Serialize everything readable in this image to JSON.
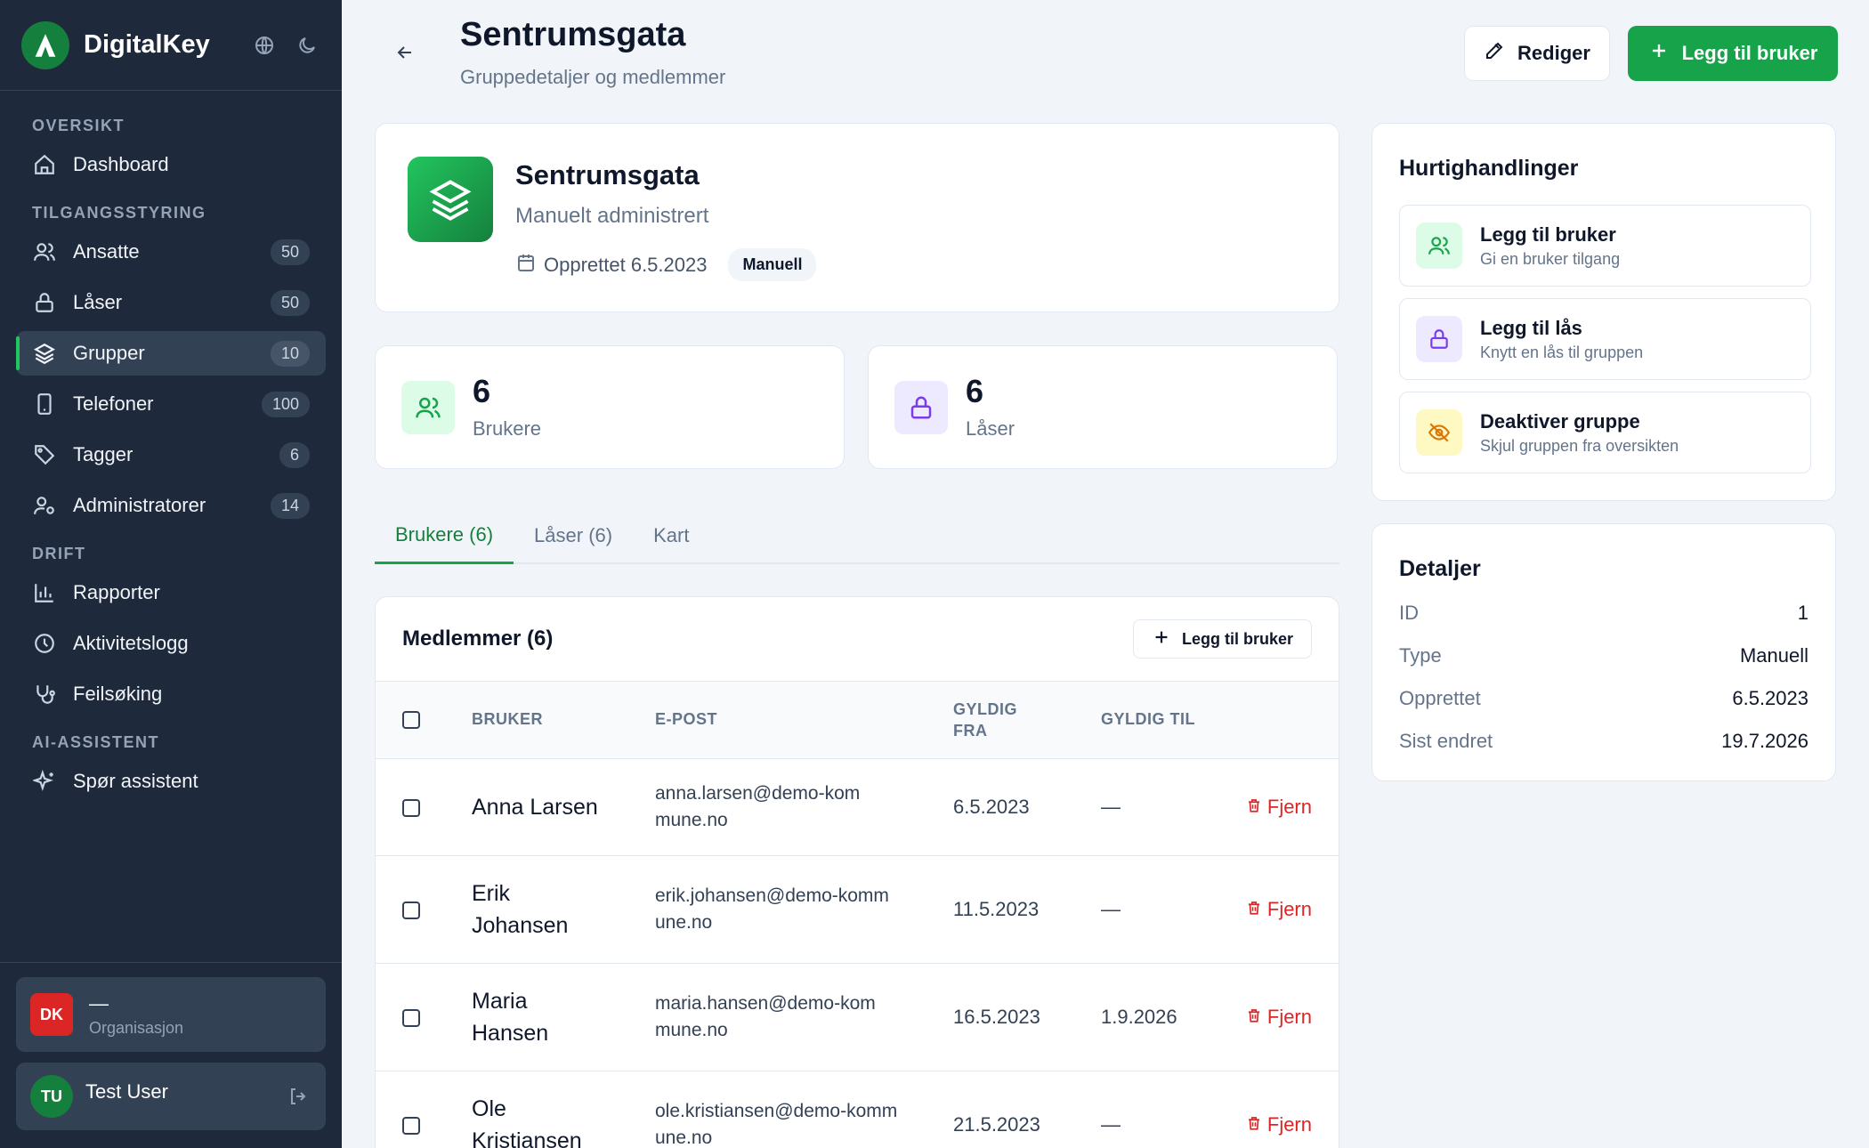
{
  "app": {
    "name": "DigitalKey"
  },
  "sidebar": {
    "sections": [
      {
        "title": "OVERSIKT"
      },
      {
        "title": "TILGANGSSTYRING"
      },
      {
        "title": "DRIFT"
      },
      {
        "title": "AI-ASSISTENT"
      }
    ],
    "items": [
      {
        "label": "Dashboard",
        "icon": "home-icon"
      },
      {
        "label": "Ansatte",
        "count": "50",
        "icon": "users-icon"
      },
      {
        "label": "Låser",
        "count": "50",
        "icon": "lock-icon"
      },
      {
        "label": "Grupper",
        "count": "10",
        "icon": "layers-icon",
        "active": true
      },
      {
        "label": "Telefoner",
        "count": "100",
        "icon": "phone-icon"
      },
      {
        "label": "Tagger",
        "count": "6",
        "icon": "tag-icon"
      },
      {
        "label": "Administratorer",
        "count": "14",
        "icon": "user-cog-icon"
      },
      {
        "label": "Rapporter",
        "icon": "bar-chart-icon"
      },
      {
        "label": "Aktivitetslogg",
        "icon": "clock-icon"
      },
      {
        "label": "Feilsøking",
        "icon": "stethoscope-icon"
      },
      {
        "label": "Spør assistent",
        "icon": "sparkles-icon"
      }
    ],
    "org": {
      "badge": "DK",
      "name": "—",
      "sub": "Organisasjon"
    },
    "user": {
      "initials": "TU",
      "name": "Test User"
    }
  },
  "header": {
    "title": "Sentrumsgata",
    "subtitle": "Gruppedetaljer og medlemmer",
    "edit_label": "Rediger",
    "add_user_label": "Legg til bruker"
  },
  "group": {
    "name": "Sentrumsgata",
    "mode": "Manuelt administrert",
    "created": "Opprettet 6.5.2023",
    "badge": "Manuell"
  },
  "stats": {
    "users": {
      "value": "6",
      "label": "Brukere"
    },
    "locks": {
      "value": "6",
      "label": "Låser"
    }
  },
  "tabs": [
    {
      "label": "Brukere (6)",
      "active": true
    },
    {
      "label": "Låser (6)"
    },
    {
      "label": "Kart"
    }
  ],
  "members": {
    "title": "Medlemmer (6)",
    "add_label": "Legg til bruker",
    "columns": {
      "user": "BRUKER",
      "email": "E-POST",
      "from": "GYLDIG FRA",
      "to": "GYLDIG TIL"
    },
    "remove_label": "Fjern",
    "rows": [
      {
        "name": "Anna Larsen",
        "email": "anna.larsen@demo-kommune.no",
        "from": "6.5.2023",
        "to": "—"
      },
      {
        "name": "Erik Johansen",
        "email": "erik.johansen@demo-kommune.no",
        "from": "11.5.2023",
        "to": "—"
      },
      {
        "name": "Maria Hansen",
        "email": "maria.hansen@demo-kommune.no",
        "from": "16.5.2023",
        "to": "1.9.2026"
      },
      {
        "name": "Ole Kristiansen",
        "email": "ole.kristiansen@demo-kommune.no",
        "from": "21.5.2023",
        "to": "—"
      }
    ]
  },
  "quick_actions": {
    "title": "Hurtighandlinger",
    "items": [
      {
        "title": "Legg til bruker",
        "sub": "Gi en bruker tilgang",
        "icon": "users-icon"
      },
      {
        "title": "Legg til lås",
        "sub": "Knytt en lås til gruppen",
        "icon": "lock-icon"
      },
      {
        "title": "Deaktiver gruppe",
        "sub": "Skjul gruppen fra oversikten",
        "icon": "eye-off-icon"
      }
    ]
  },
  "details": {
    "title": "Detaljer",
    "rows": [
      {
        "key": "ID",
        "value": "1"
      },
      {
        "key": "Type",
        "value": "Manuell"
      },
      {
        "key": "Opprettet",
        "value": "6.5.2023"
      },
      {
        "key": "Sist endret",
        "value": "19.7.2026"
      }
    ]
  },
  "colors": {
    "accent": "#16a34a",
    "sidebar": "#1e293b",
    "danger": "#dc2626"
  }
}
